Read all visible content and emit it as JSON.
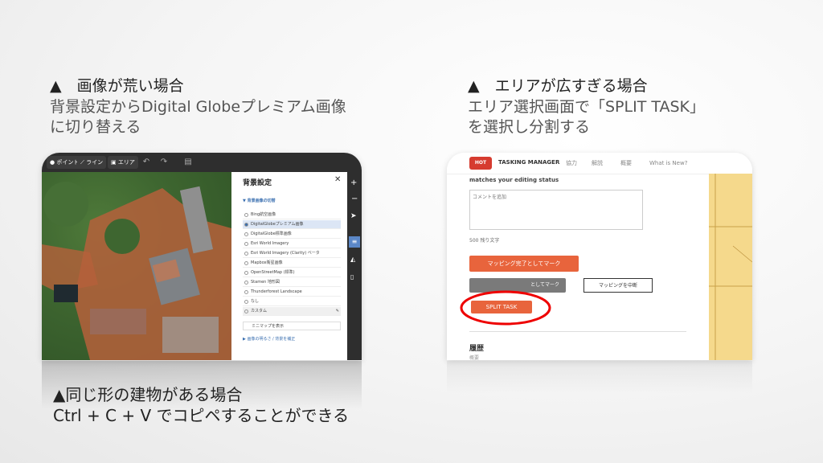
{
  "left": {
    "title": "▲　画像が荒い場合",
    "desc_line1": "背景設定からDigital Globeプレミアム画像",
    "desc_line2": "に切り替える",
    "toolbar": {
      "point": "ポイント",
      "line": "ライン",
      "area": "エリア"
    },
    "panel": {
      "title": "背景設定",
      "section": "背景画像の切替",
      "items": [
        "Bing航空画像",
        "DigitalGlobeプレミアム画像",
        "DigitalGlobe標準画像",
        "Esri World Imagery",
        "Esri World Imagery (Clarity) ベータ",
        "Mapbox衛星画像",
        "OpenStreetMap (標準)",
        "Stamen 地形図",
        "Thunderforest Landscape",
        "なし",
        "カスタム"
      ],
      "minimap": "ミニマップを表示",
      "offset": "画像の明るさ / 背景を補正"
    }
  },
  "right": {
    "title": "▲　エリアが広すぎる場合",
    "desc_line1": "エリア選択画面で「SPLIT TASK」",
    "desc_line2": "を選択し分割する",
    "brand": "HOT",
    "app": "TASKING MANAGER",
    "nav": [
      "協力",
      "解説",
      "概要",
      "What is New?"
    ],
    "status_text": "matches your editing status",
    "comment_placeholder": "コメントを追加",
    "char_count": "500 残り文字",
    "mark_done": "マッピング完了としてマーク",
    "mark_invalid": "としてマーク",
    "stop_mapping": "マッピングを中断",
    "split": "SPLIT TASK",
    "history": "履歴",
    "history_sub": "概要"
  },
  "bottom": {
    "line1": "▲同じ形の建物がある場合",
    "line2": "Ctrl + C + V でコピペすることができる"
  }
}
